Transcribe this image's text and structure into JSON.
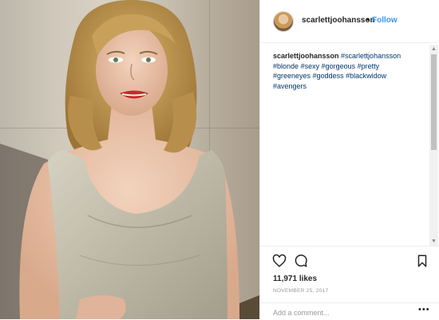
{
  "post": {
    "username": "scarlettjoohansson",
    "separator": "•",
    "follow_label": "Follow",
    "caption": {
      "username": "scarlettjoohansson",
      "hashtags": [
        "#scarlettjohansson",
        "#blonde",
        "#sexy",
        "#gorgeous",
        "#pretty",
        "#greeneyes",
        "#goddess",
        "#blackwidow",
        "#avengers"
      ]
    },
    "likes": "11,971 likes",
    "date": "NOVEMBER 25, 2017",
    "comment_placeholder": "Add a comment...",
    "more_label": "•••"
  },
  "scrollbar": {
    "up": "▲",
    "down": "▼"
  },
  "icons": {
    "like": "heart-icon",
    "comment": "speech-bubble-icon",
    "save": "bookmark-icon",
    "avatar": "profile-picture"
  },
  "colors": {
    "link_blue": "#3897f0",
    "hashtag": "#003569",
    "text": "#262626",
    "muted": "#999999",
    "border": "#efefef"
  }
}
